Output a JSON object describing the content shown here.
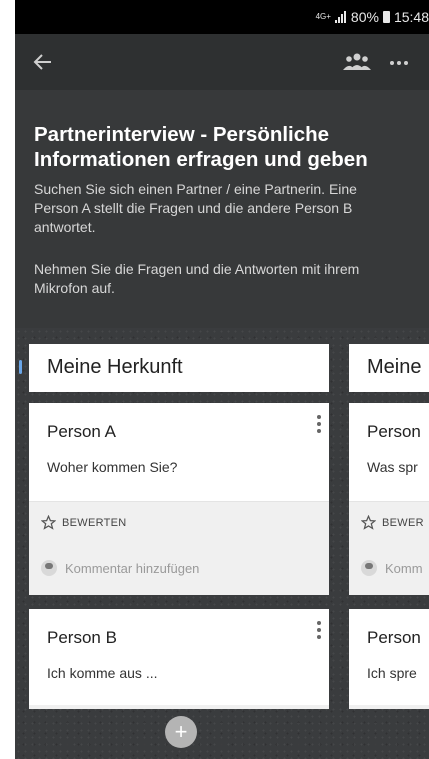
{
  "status_bar": {
    "network": "4G+",
    "battery": "80%",
    "time": "15:48"
  },
  "header": {
    "title": "Partnerinterview - Persönliche Informationen erfragen und geben",
    "description": "Suchen Sie sich einen Partner / eine Partnerin. Eine Person A stellt die Fragen und die andere Person B antwortet.",
    "instruction": "Nehmen Sie die Fragen und die Antworten mit ihrem Mikrofon auf."
  },
  "columns": [
    {
      "title": "Meine Herkunft",
      "cards": [
        {
          "person": "Person A",
          "question": "Woher kommen Sie?",
          "rate_label": "BEWERTEN",
          "comment_placeholder": "Kommentar hinzufügen"
        },
        {
          "person": "Person B",
          "question": "Ich komme aus ..."
        }
      ]
    },
    {
      "title": "Meine",
      "cards": [
        {
          "person": "Person",
          "question": "Was spr",
          "rate_label": "BEWER",
          "comment_placeholder": "Komm"
        },
        {
          "person": "Person",
          "question": "Ich spre"
        }
      ]
    }
  ],
  "fab": {
    "label": "+"
  },
  "colors": {
    "header_bg": "#37393a",
    "board_bg": "#3a3c3e",
    "card_bg": "#ffffff",
    "footer_bg": "#f0f0f0",
    "fab_bg": "#b4b4b4"
  }
}
